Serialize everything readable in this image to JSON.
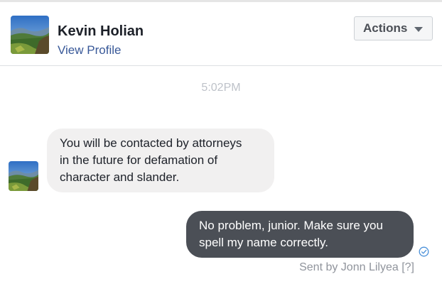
{
  "header": {
    "name": "Kevin Holian",
    "view_profile_label": "View Profile",
    "actions_label": "Actions",
    "actions_icon": "caret-down-icon"
  },
  "thread": {
    "timestamp": "5:02PM",
    "messages": [
      {
        "direction": "incoming",
        "text": "You will be contacted by attorneys\nin the future for defamation of\ncharacter and slander."
      },
      {
        "direction": "outgoing",
        "text": "No problem, junior. Make sure you\nspell my name correctly."
      }
    ],
    "seen_icon": "check-circle-icon",
    "sent_by": "Sent by Jonn Lilyea",
    "help_label": "[?]"
  },
  "colors": {
    "link": "#385898",
    "incoming_bubble": "#f1f0f0",
    "outgoing_bubble": "#4b4f56",
    "seen_check": "#4a90d9"
  }
}
